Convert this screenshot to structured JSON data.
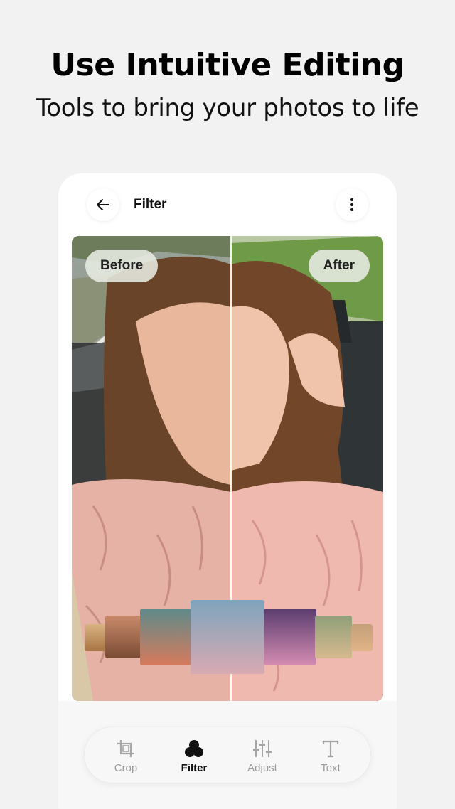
{
  "headline": "Use Intuitive Editing",
  "subheadline": "Tools to bring your photos to life",
  "screen": {
    "title": "Filter",
    "back_icon": "arrow-left-icon",
    "more_icon": "more-vertical-icon"
  },
  "compare": {
    "before_label": "Before",
    "after_label": "After"
  },
  "toolbar": {
    "items": [
      {
        "label": "Crop",
        "icon": "crop-icon",
        "active": false
      },
      {
        "label": "Filter",
        "icon": "filter-icon",
        "active": true
      },
      {
        "label": "Adjust",
        "icon": "sliders-icon",
        "active": false
      },
      {
        "label": "Text",
        "icon": "text-icon",
        "active": false
      }
    ]
  },
  "colors": {
    "background": "#f2f2f2",
    "active_marker": "#f2b705",
    "inactive_label": "#9a9a9a"
  }
}
